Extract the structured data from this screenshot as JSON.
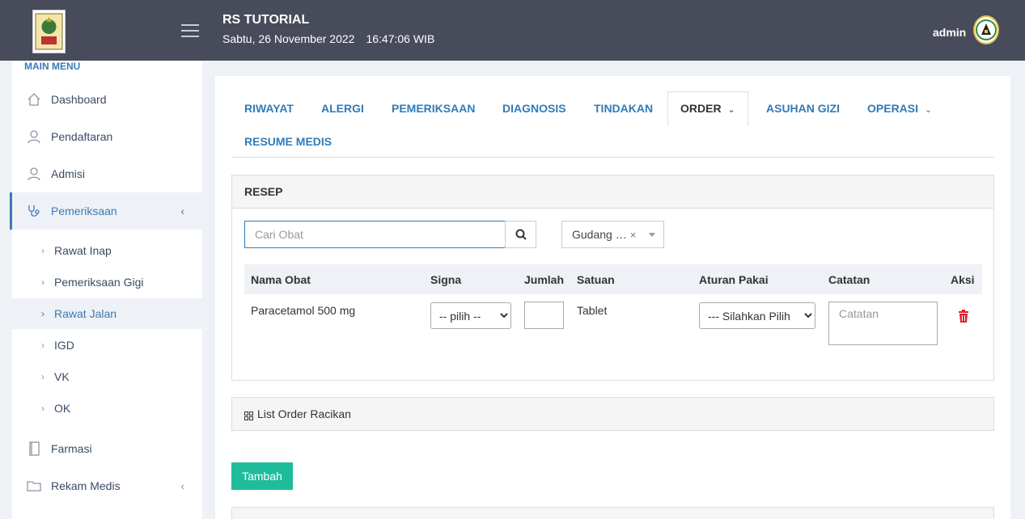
{
  "header": {
    "app_title": "RS TUTORIAL",
    "date": "Sabtu, 26 November 2022",
    "time": "16:47:06 WIB",
    "user": "admin"
  },
  "sidebar": {
    "section_label": "MAIN MENU",
    "items": [
      {
        "label": "Dashboard",
        "icon": "home-icon"
      },
      {
        "label": "Pendaftaran",
        "icon": "user-icon"
      },
      {
        "label": "Admisi",
        "icon": "user-icon"
      },
      {
        "label": "Pemeriksaan",
        "icon": "stethoscope-icon",
        "active": true
      },
      {
        "label": "Farmasi",
        "icon": "book-icon"
      },
      {
        "label": "Rekam Medis",
        "icon": "folder-icon"
      }
    ],
    "sub_items": [
      {
        "label": "Rawat Inap"
      },
      {
        "label": "Pemeriksaan Gigi"
      },
      {
        "label": "Rawat Jalan",
        "active": true
      },
      {
        "label": "IGD"
      },
      {
        "label": "VK"
      },
      {
        "label": "OK"
      }
    ]
  },
  "tabs": [
    {
      "label": "RIWAYAT"
    },
    {
      "label": "ALERGI"
    },
    {
      "label": "PEMERIKSAAN"
    },
    {
      "label": "DIAGNOSIS"
    },
    {
      "label": "TINDAKAN"
    },
    {
      "label": "ORDER",
      "active": true
    },
    {
      "label": "ASUHAN GIZI"
    },
    {
      "label": "OPERASI"
    },
    {
      "label": "RESUME MEDIS"
    }
  ],
  "resep": {
    "title": "RESEP",
    "search_placeholder": "Cari Obat",
    "gudang_value": "Gudang …",
    "columns": [
      "Nama Obat",
      "Signa",
      "Jumlah",
      "Satuan",
      "Aturan Pakai",
      "Catatan",
      "Aksi"
    ],
    "row": {
      "nama_obat": "Paracetamol 500 mg",
      "signa": "-- pilih --",
      "jumlah": "",
      "satuan": "Tablet",
      "aturan_pakai": "--- Silahkan Pilih",
      "catatan_placeholder": "Catatan"
    }
  },
  "racikan": {
    "label": "List Order Racikan"
  },
  "buttons": {
    "tambah": "Tambah"
  },
  "colors": {
    "topbar": "#474b5a",
    "link": "#2f7cb9",
    "primary_btn": "#1fbc9c",
    "danger": "#e0212f"
  }
}
